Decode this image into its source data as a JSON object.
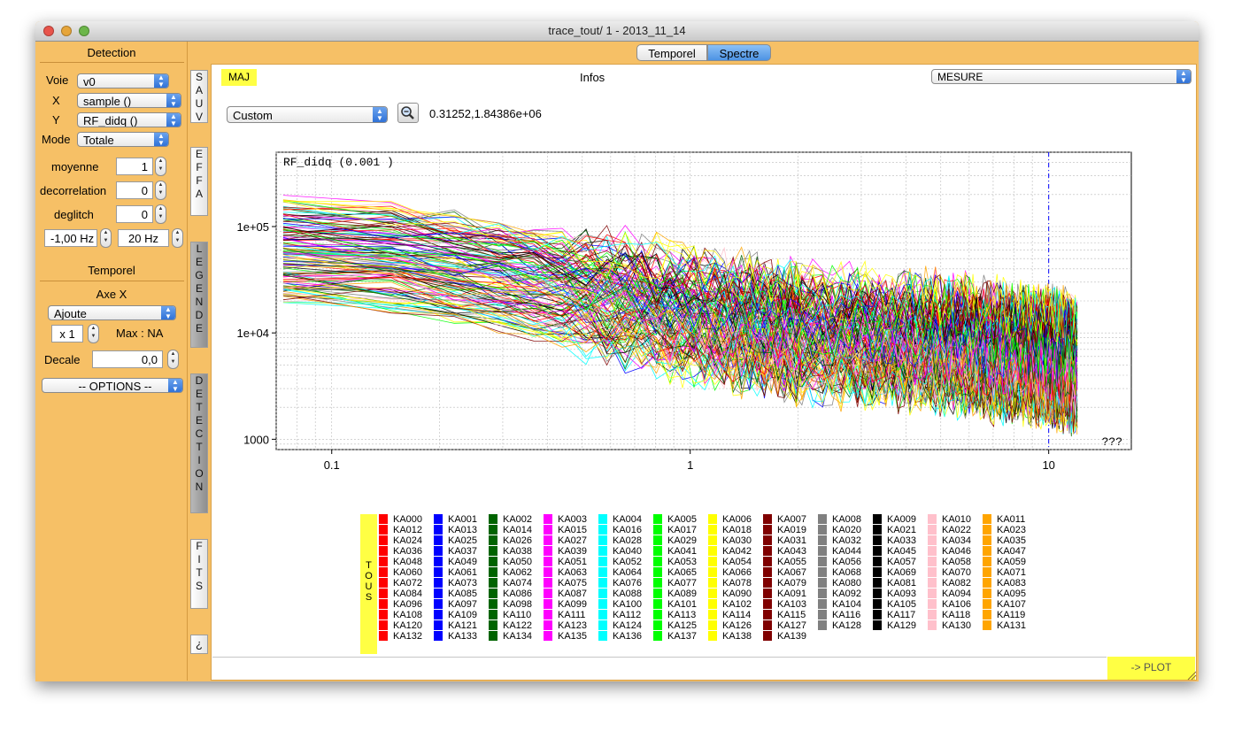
{
  "window": {
    "title": "trace_tout/ 1 - 2013_11_14",
    "traffic_lights": [
      "#e8544b",
      "#e6a53a",
      "#6cb64a"
    ]
  },
  "left_panel": {
    "detection_header": "Detection",
    "voie_label": "Voie",
    "voie_value": "v0",
    "x_label": "X",
    "x_value": "sample ()",
    "y_label": "Y",
    "y_value": "RF_didq ()",
    "mode_label": "Mode",
    "mode_value": "Totale",
    "moyenne_label": "moyenne",
    "moyenne_value": "1",
    "decorrelation_label": "decorrelation",
    "decorrelation_value": "0",
    "deglitch_label": "deglitch",
    "deglitch_value": "0",
    "freq_low": "-1,00 Hz",
    "freq_high": "20 Hz",
    "temporel_header": "Temporel",
    "axe_x_label": "Axe X",
    "axe_x_value": "Ajoute",
    "scale_value": "x 1",
    "max_label": "Max : NA",
    "decale_label": "Decale",
    "decale_value": "0,0",
    "options_value": "-- OPTIONS --"
  },
  "side_tabs": [
    "SAUV",
    "EFFA",
    "LEGENDE",
    "DETECTION",
    "FITS",
    "¿"
  ],
  "top_tabs": [
    "Temporel",
    "Spectre"
  ],
  "active_tab": "Spectre",
  "toolbar": {
    "maj_label": "MAJ",
    "infos_label": "Infos",
    "mesure_value": "MESURE",
    "custom_value": "Custom",
    "zoom_icon": "magnifier-icon",
    "coords": "0.31252,1.84386e+06"
  },
  "chart_data": {
    "type": "line",
    "title": "RF_didq (0.001 )",
    "corner_label": "???",
    "xscale": "log",
    "yscale": "log",
    "xlim": [
      0.07,
      17
    ],
    "ylim": [
      800,
      500000
    ],
    "x_ticks": [
      0.1,
      1,
      10
    ],
    "x_tick_labels": [
      "0.1",
      "1",
      "10"
    ],
    "y_ticks": [
      1000,
      10000,
      100000
    ],
    "y_tick_labels": [
      "1000",
      "1e+04",
      "1e+05"
    ],
    "grid": true,
    "marker_x": 10,
    "series_count": 140,
    "trend": {
      "x": [
        0.07,
        0.1,
        0.2,
        0.5,
        1,
        2,
        5,
        10,
        12
      ],
      "y": [
        60000,
        60000,
        45000,
        25000,
        15000,
        10000,
        8000,
        6000,
        5000
      ]
    }
  },
  "legend": {
    "tous_label": "TOUS",
    "colors": [
      "#ff0000",
      "#0000ff",
      "#006400",
      "#ff00ff",
      "#00ffff",
      "#00ff00",
      "#ffff00",
      "#800000",
      "#808080",
      "#000000",
      "#ffc0cb",
      "#ffa500"
    ],
    "columns": [
      [
        "KA000",
        "KA012",
        "KA024",
        "KA036",
        "KA048",
        "KA060",
        "KA072",
        "KA084",
        "KA096",
        "KA108",
        "KA120",
        "KA132"
      ],
      [
        "KA001",
        "KA013",
        "KA025",
        "KA037",
        "KA049",
        "KA061",
        "KA073",
        "KA085",
        "KA097",
        "KA109",
        "KA121",
        "KA133"
      ],
      [
        "KA002",
        "KA014",
        "KA026",
        "KA038",
        "KA050",
        "KA062",
        "KA074",
        "KA086",
        "KA098",
        "KA110",
        "KA122",
        "KA134"
      ],
      [
        "KA003",
        "KA015",
        "KA027",
        "KA039",
        "KA051",
        "KA063",
        "KA075",
        "KA087",
        "KA099",
        "KA111",
        "KA123",
        "KA135"
      ],
      [
        "KA004",
        "KA016",
        "KA028",
        "KA040",
        "KA052",
        "KA064",
        "KA076",
        "KA088",
        "KA100",
        "KA112",
        "KA124",
        "KA136"
      ],
      [
        "KA005",
        "KA017",
        "KA029",
        "KA041",
        "KA053",
        "KA065",
        "KA077",
        "KA089",
        "KA101",
        "KA113",
        "KA125",
        "KA137"
      ],
      [
        "KA006",
        "KA018",
        "KA030",
        "KA042",
        "KA054",
        "KA066",
        "KA078",
        "KA090",
        "KA102",
        "KA114",
        "KA126",
        "KA138"
      ],
      [
        "KA007",
        "KA019",
        "KA031",
        "KA043",
        "KA055",
        "KA067",
        "KA079",
        "KA091",
        "KA103",
        "KA115",
        "KA127",
        "KA139"
      ],
      [
        "KA008",
        "KA020",
        "KA032",
        "KA044",
        "KA056",
        "KA068",
        "KA080",
        "KA092",
        "KA104",
        "KA116",
        "KA128"
      ],
      [
        "KA009",
        "KA021",
        "KA033",
        "KA045",
        "KA057",
        "KA069",
        "KA081",
        "KA093",
        "KA105",
        "KA117",
        "KA129"
      ],
      [
        "KA010",
        "KA022",
        "KA034",
        "KA046",
        "KA058",
        "KA070",
        "KA082",
        "KA094",
        "KA106",
        "KA118",
        "KA130"
      ],
      [
        "KA011",
        "KA023",
        "KA035",
        "KA047",
        "KA059",
        "KA071",
        "KA083",
        "KA095",
        "KA107",
        "KA119",
        "KA131"
      ]
    ]
  },
  "bottom": {
    "command_value": "",
    "plot_label": "-> PLOT"
  }
}
